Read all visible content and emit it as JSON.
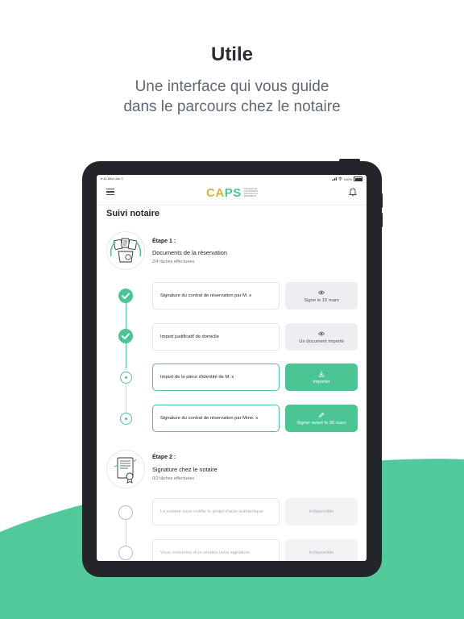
{
  "marketing": {
    "headline": "Utile",
    "subtitle_line1": "Une interface qui vous guide",
    "subtitle_line2": "dans le parcours chez le notaire"
  },
  "status_bar": {
    "time": "9:41 Mon Jun 3",
    "battery": "100%"
  },
  "app": {
    "logo_letters": [
      "C",
      "A",
      "P",
      "S"
    ],
    "logo_tagline": [
      "COLLEGE DE",
      "L'ACCESSION",
      "SOCIALE A LA",
      "PROPRIETE"
    ],
    "page_title": "Suivi notaire"
  },
  "steps": [
    {
      "label": "Étape 1 :",
      "name": "Documents de la réservation",
      "progress": "2/4 tâches effectuées",
      "icon": "documents-icon",
      "tasks": [
        {
          "label": "Signature du contrat de réservation par M. x",
          "status": "done",
          "action_label": "Signé le 15 mars",
          "action_icon": "eye-icon",
          "action_style": "grey"
        },
        {
          "label": "Import justificatif de domicile",
          "status": "done",
          "action_label": "Un document importé",
          "action_icon": "eye-icon",
          "action_style": "grey"
        },
        {
          "label": "Import de la pièce d'identité de M. x",
          "status": "current",
          "action_label": "Importer",
          "action_icon": "download-icon",
          "action_style": "green"
        },
        {
          "label": "Signature du contrat de réservation par Mme. x",
          "status": "current",
          "action_label": "Signer avant le 30 mars",
          "action_icon": "pen-icon",
          "action_style": "green"
        }
      ]
    },
    {
      "label": "Étape 2 :",
      "name": "Signature chez le notaire",
      "progress": "0/3 tâches effectuées",
      "icon": "contract-icon",
      "tasks": [
        {
          "label": "Le notaire vous notifie le projet d'acte authentique",
          "status": "pending",
          "action_label": "Indisponible",
          "action_style": "off"
        },
        {
          "label": "Vous convenez d'un rendez-vous signature",
          "status": "pending",
          "action_label": "Indisponible",
          "action_style": "off"
        }
      ]
    }
  ],
  "colors": {
    "accent": "#4cc595",
    "logo_gold": "#d9b23a",
    "wave": "#52c99b"
  }
}
